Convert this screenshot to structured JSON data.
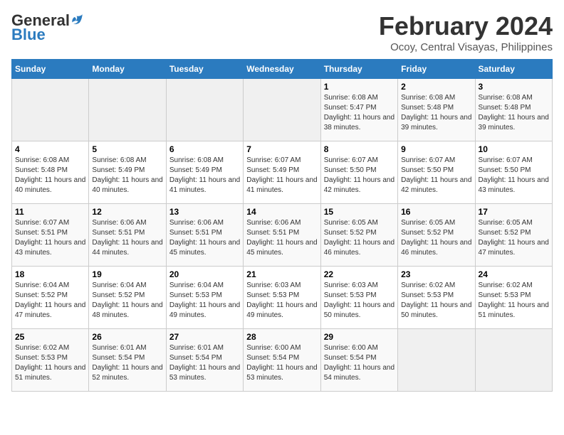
{
  "logo": {
    "general": "General",
    "blue": "Blue"
  },
  "title": "February 2024",
  "subtitle": "Ocoy, Central Visayas, Philippines",
  "weekdays": [
    "Sunday",
    "Monday",
    "Tuesday",
    "Wednesday",
    "Thursday",
    "Friday",
    "Saturday"
  ],
  "weeks": [
    [
      {
        "day": "",
        "info": ""
      },
      {
        "day": "",
        "info": ""
      },
      {
        "day": "",
        "info": ""
      },
      {
        "day": "",
        "info": ""
      },
      {
        "day": "1",
        "info": "Sunrise: 6:08 AM\nSunset: 5:47 PM\nDaylight: 11 hours and 38 minutes."
      },
      {
        "day": "2",
        "info": "Sunrise: 6:08 AM\nSunset: 5:48 PM\nDaylight: 11 hours and 39 minutes."
      },
      {
        "day": "3",
        "info": "Sunrise: 6:08 AM\nSunset: 5:48 PM\nDaylight: 11 hours and 39 minutes."
      }
    ],
    [
      {
        "day": "4",
        "info": "Sunrise: 6:08 AM\nSunset: 5:48 PM\nDaylight: 11 hours and 40 minutes."
      },
      {
        "day": "5",
        "info": "Sunrise: 6:08 AM\nSunset: 5:49 PM\nDaylight: 11 hours and 40 minutes."
      },
      {
        "day": "6",
        "info": "Sunrise: 6:08 AM\nSunset: 5:49 PM\nDaylight: 11 hours and 41 minutes."
      },
      {
        "day": "7",
        "info": "Sunrise: 6:07 AM\nSunset: 5:49 PM\nDaylight: 11 hours and 41 minutes."
      },
      {
        "day": "8",
        "info": "Sunrise: 6:07 AM\nSunset: 5:50 PM\nDaylight: 11 hours and 42 minutes."
      },
      {
        "day": "9",
        "info": "Sunrise: 6:07 AM\nSunset: 5:50 PM\nDaylight: 11 hours and 42 minutes."
      },
      {
        "day": "10",
        "info": "Sunrise: 6:07 AM\nSunset: 5:50 PM\nDaylight: 11 hours and 43 minutes."
      }
    ],
    [
      {
        "day": "11",
        "info": "Sunrise: 6:07 AM\nSunset: 5:51 PM\nDaylight: 11 hours and 43 minutes."
      },
      {
        "day": "12",
        "info": "Sunrise: 6:06 AM\nSunset: 5:51 PM\nDaylight: 11 hours and 44 minutes."
      },
      {
        "day": "13",
        "info": "Sunrise: 6:06 AM\nSunset: 5:51 PM\nDaylight: 11 hours and 45 minutes."
      },
      {
        "day": "14",
        "info": "Sunrise: 6:06 AM\nSunset: 5:51 PM\nDaylight: 11 hours and 45 minutes."
      },
      {
        "day": "15",
        "info": "Sunrise: 6:05 AM\nSunset: 5:52 PM\nDaylight: 11 hours and 46 minutes."
      },
      {
        "day": "16",
        "info": "Sunrise: 6:05 AM\nSunset: 5:52 PM\nDaylight: 11 hours and 46 minutes."
      },
      {
        "day": "17",
        "info": "Sunrise: 6:05 AM\nSunset: 5:52 PM\nDaylight: 11 hours and 47 minutes."
      }
    ],
    [
      {
        "day": "18",
        "info": "Sunrise: 6:04 AM\nSunset: 5:52 PM\nDaylight: 11 hours and 47 minutes."
      },
      {
        "day": "19",
        "info": "Sunrise: 6:04 AM\nSunset: 5:52 PM\nDaylight: 11 hours and 48 minutes."
      },
      {
        "day": "20",
        "info": "Sunrise: 6:04 AM\nSunset: 5:53 PM\nDaylight: 11 hours and 49 minutes."
      },
      {
        "day": "21",
        "info": "Sunrise: 6:03 AM\nSunset: 5:53 PM\nDaylight: 11 hours and 49 minutes."
      },
      {
        "day": "22",
        "info": "Sunrise: 6:03 AM\nSunset: 5:53 PM\nDaylight: 11 hours and 50 minutes."
      },
      {
        "day": "23",
        "info": "Sunrise: 6:02 AM\nSunset: 5:53 PM\nDaylight: 11 hours and 50 minutes."
      },
      {
        "day": "24",
        "info": "Sunrise: 6:02 AM\nSunset: 5:53 PM\nDaylight: 11 hours and 51 minutes."
      }
    ],
    [
      {
        "day": "25",
        "info": "Sunrise: 6:02 AM\nSunset: 5:53 PM\nDaylight: 11 hours and 51 minutes."
      },
      {
        "day": "26",
        "info": "Sunrise: 6:01 AM\nSunset: 5:54 PM\nDaylight: 11 hours and 52 minutes."
      },
      {
        "day": "27",
        "info": "Sunrise: 6:01 AM\nSunset: 5:54 PM\nDaylight: 11 hours and 53 minutes."
      },
      {
        "day": "28",
        "info": "Sunrise: 6:00 AM\nSunset: 5:54 PM\nDaylight: 11 hours and 53 minutes."
      },
      {
        "day": "29",
        "info": "Sunrise: 6:00 AM\nSunset: 5:54 PM\nDaylight: 11 hours and 54 minutes."
      },
      {
        "day": "",
        "info": ""
      },
      {
        "day": "",
        "info": ""
      }
    ]
  ]
}
